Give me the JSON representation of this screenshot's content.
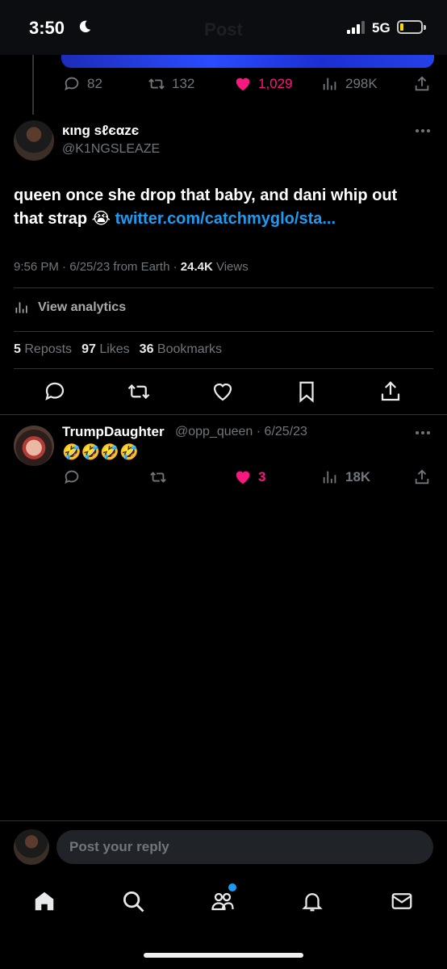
{
  "status_bar": {
    "time": "3:50",
    "network": "5G",
    "ghost_title": "Post"
  },
  "prev_post_stats": {
    "replies": "82",
    "reposts": "132",
    "likes": "1,029",
    "views": "298K"
  },
  "post": {
    "author_name": "ĸιng ѕℓєαzє",
    "author_handle": "@K1NGSLEAZE",
    "text": "queen once she drop that baby, and dani whip out that strap 😭 ",
    "link": "twitter.com/catchmyglo/sta...",
    "meta_time": "9:56 PM · 6/25/23 from Earth · ",
    "meta_views_count": "24.4K",
    "meta_views_label": " Views",
    "view_analytics": "View analytics",
    "reposts_count": "5",
    "reposts_label": "Reposts",
    "likes_count": "97",
    "likes_label": "Likes",
    "bookmarks_count": "36",
    "bookmarks_label": "Bookmarks"
  },
  "reply": {
    "author_name": "TrumpDaughter",
    "author_handle_date": "@opp_queen · 6/25/23",
    "text": "🤣🤣🤣🤣",
    "likes": "3",
    "views": "18K"
  },
  "composer": {
    "placeholder": "Post your reply"
  },
  "colors": {
    "accent": "#1d9bf0",
    "like": "#f91880",
    "muted": "#71767b",
    "background": "#000000"
  },
  "icons": [
    "moon-icon",
    "signal-icon",
    "battery-icon",
    "reply-icon",
    "repost-icon",
    "like-icon",
    "views-icon",
    "share-icon",
    "bookmark-icon",
    "more-icon",
    "analytics-icon",
    "home-icon",
    "search-icon",
    "communities-icon",
    "notifications-icon",
    "messages-icon"
  ]
}
